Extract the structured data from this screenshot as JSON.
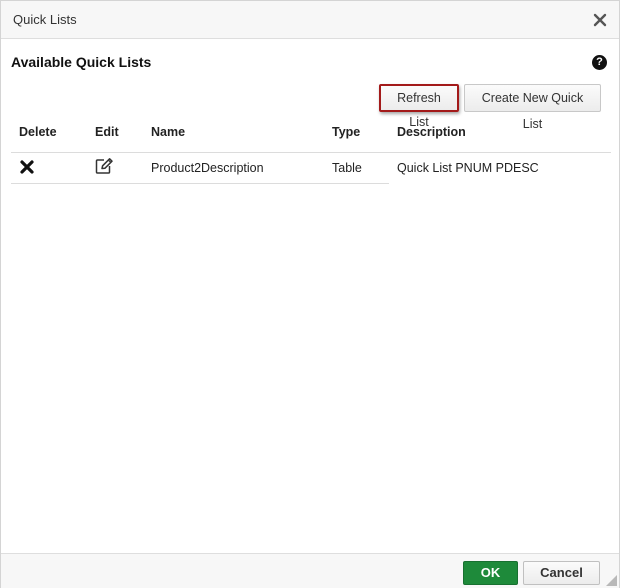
{
  "dialog": {
    "title": "Quick Lists",
    "close_icon": "close-icon"
  },
  "main": {
    "heading": "Available Quick Lists",
    "help_symbol": "?",
    "refresh_label": "Refresh List",
    "create_label": "Create New Quick List"
  },
  "table": {
    "columns": [
      "Delete",
      "Edit",
      "Name",
      "Type",
      "Description"
    ],
    "rows": [
      {
        "delete_icon": "delete-x-icon",
        "edit_icon": "edit-pencil-icon",
        "name": "Product2Description",
        "type": "Table",
        "description": "Quick List PNUM PDESC"
      }
    ]
  },
  "footer": {
    "ok_label": "OK",
    "cancel_label": "Cancel"
  },
  "colors": {
    "ok_button": "#1e8a3a",
    "highlight_border": "#a31a1a"
  }
}
